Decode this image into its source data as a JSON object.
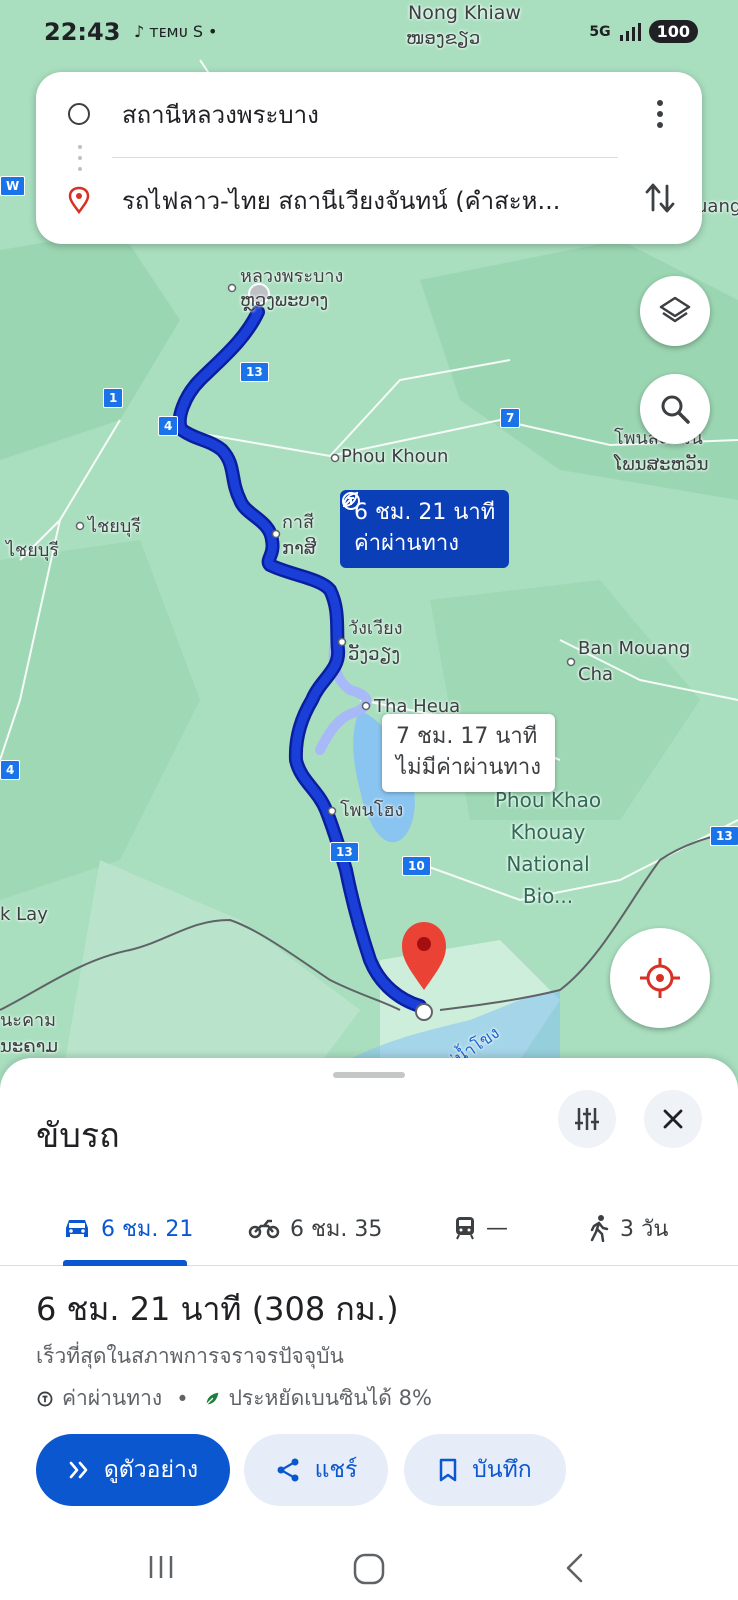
{
  "status_bar": {
    "time": "22:43",
    "notif_icons": "♪ ᴛᴇᴍᴜ S •",
    "network": "5G",
    "battery": "100"
  },
  "search": {
    "origin": "สถานีหลวงพระบาง",
    "destination": "รถไฟลาว-ไทย สถานีเวียงจันทน์ (คำสะห...",
    "icons": [
      "origin-circle-icon",
      "destination-pin-icon",
      "more-vert-icon",
      "swap-icon"
    ]
  },
  "map": {
    "labels": {
      "nong_khiaw": "Nong Khiaw",
      "nong_khiaw_lao": "ໜອງຂຽວ",
      "luang_prabang": "หลวงพระบาง",
      "luang_prabang_lao": "ຫຼວງພະບາງ",
      "phou_khoun": "Phou Khoun",
      "kasi": "กาสี",
      "kasi_lao": "ກາສີ",
      "vang_vieng": "วังเวียง",
      "vang_vieng_lao": "ວັງວຽງ",
      "xayaburi": "ไชยบุรี",
      "xayaburi2": "ไชยบุรี",
      "ban_mouang": "Ban Mouang",
      "cha": "Cha",
      "tha_heua": "Tha Heua",
      "phonhong": "โพนโฮง",
      "phou_khao": "Phou Khao",
      "khouay": "Khouay",
      "national": "National",
      "bio": "Bio...",
      "phonsavan": "โพนสะหวัน",
      "phonsavan_lao": "ໂພນສະຫວັນ",
      "k_lay": "k Lay",
      "nakham": "นะคาม",
      "nakham_lao": "ນະຄາມ",
      "mouang": "uang",
      "mekong": "แม่น้ำโขง"
    },
    "shields": [
      "13",
      "1",
      "4",
      "7",
      "13",
      "10",
      "13",
      "4",
      "W"
    ],
    "primary_route": {
      "time": "6 ชม. 21 นาที",
      "toll": "ค่าผ่านทาง"
    },
    "alt_route": {
      "time": "7 ชม. 17 นาที",
      "toll": "ไม่มีค่าผ่านทาง"
    },
    "colors": {
      "route": "#1a3fd8",
      "route_outline": "#0b1f9e",
      "alt_route": "#a7b9f7",
      "pin": "#ea4335",
      "water": "#8ac4f0"
    }
  },
  "sheet": {
    "title": "ขับรถ",
    "modes": [
      {
        "icon": "car-icon",
        "label": "6 ชม. 21"
      },
      {
        "icon": "motorcycle-icon",
        "label": "6 ชม. 35"
      },
      {
        "icon": "transit-icon",
        "label": "—"
      },
      {
        "icon": "walk-icon",
        "label": "3 วัน"
      }
    ],
    "summary": "6 ชม. 21 นาที (308 กม.)",
    "subtitle": "เร็วที่สุดในสภาพการจราจรปัจจุบัน",
    "toll": "ค่าผ่านทาง",
    "fuel": "ประหยัดเบนซินได้ 8%",
    "buttons": {
      "preview": "ดูตัวอย่าง",
      "share": "แชร์",
      "save": "บันทึก"
    }
  }
}
